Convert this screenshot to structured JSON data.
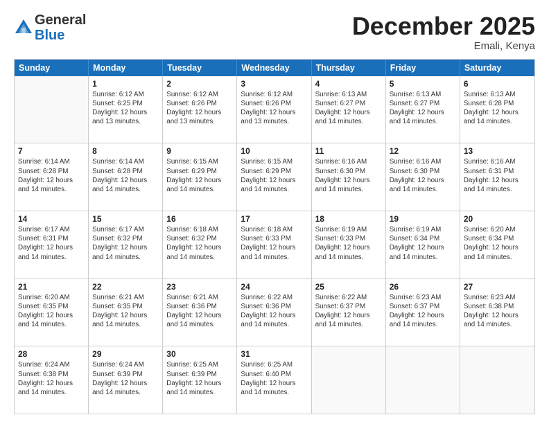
{
  "logo": {
    "general": "General",
    "blue": "Blue"
  },
  "title": "December 2025",
  "location": "Emali, Kenya",
  "header_days": [
    "Sunday",
    "Monday",
    "Tuesday",
    "Wednesday",
    "Thursday",
    "Friday",
    "Saturday"
  ],
  "weeks": [
    [
      {
        "day": "",
        "sunrise": "",
        "sunset": "",
        "daylight": ""
      },
      {
        "day": "1",
        "sunrise": "Sunrise: 6:12 AM",
        "sunset": "Sunset: 6:25 PM",
        "daylight": "Daylight: 12 hours and 13 minutes."
      },
      {
        "day": "2",
        "sunrise": "Sunrise: 6:12 AM",
        "sunset": "Sunset: 6:26 PM",
        "daylight": "Daylight: 12 hours and 13 minutes."
      },
      {
        "day": "3",
        "sunrise": "Sunrise: 6:12 AM",
        "sunset": "Sunset: 6:26 PM",
        "daylight": "Daylight: 12 hours and 13 minutes."
      },
      {
        "day": "4",
        "sunrise": "Sunrise: 6:13 AM",
        "sunset": "Sunset: 6:27 PM",
        "daylight": "Daylight: 12 hours and 14 minutes."
      },
      {
        "day": "5",
        "sunrise": "Sunrise: 6:13 AM",
        "sunset": "Sunset: 6:27 PM",
        "daylight": "Daylight: 12 hours and 14 minutes."
      },
      {
        "day": "6",
        "sunrise": "Sunrise: 6:13 AM",
        "sunset": "Sunset: 6:28 PM",
        "daylight": "Daylight: 12 hours and 14 minutes."
      }
    ],
    [
      {
        "day": "7",
        "sunrise": "Sunrise: 6:14 AM",
        "sunset": "Sunset: 6:28 PM",
        "daylight": "Daylight: 12 hours and 14 minutes."
      },
      {
        "day": "8",
        "sunrise": "Sunrise: 6:14 AM",
        "sunset": "Sunset: 6:28 PM",
        "daylight": "Daylight: 12 hours and 14 minutes."
      },
      {
        "day": "9",
        "sunrise": "Sunrise: 6:15 AM",
        "sunset": "Sunset: 6:29 PM",
        "daylight": "Daylight: 12 hours and 14 minutes."
      },
      {
        "day": "10",
        "sunrise": "Sunrise: 6:15 AM",
        "sunset": "Sunset: 6:29 PM",
        "daylight": "Daylight: 12 hours and 14 minutes."
      },
      {
        "day": "11",
        "sunrise": "Sunrise: 6:16 AM",
        "sunset": "Sunset: 6:30 PM",
        "daylight": "Daylight: 12 hours and 14 minutes."
      },
      {
        "day": "12",
        "sunrise": "Sunrise: 6:16 AM",
        "sunset": "Sunset: 6:30 PM",
        "daylight": "Daylight: 12 hours and 14 minutes."
      },
      {
        "day": "13",
        "sunrise": "Sunrise: 6:16 AM",
        "sunset": "Sunset: 6:31 PM",
        "daylight": "Daylight: 12 hours and 14 minutes."
      }
    ],
    [
      {
        "day": "14",
        "sunrise": "Sunrise: 6:17 AM",
        "sunset": "Sunset: 6:31 PM",
        "daylight": "Daylight: 12 hours and 14 minutes."
      },
      {
        "day": "15",
        "sunrise": "Sunrise: 6:17 AM",
        "sunset": "Sunset: 6:32 PM",
        "daylight": "Daylight: 12 hours and 14 minutes."
      },
      {
        "day": "16",
        "sunrise": "Sunrise: 6:18 AM",
        "sunset": "Sunset: 6:32 PM",
        "daylight": "Daylight: 12 hours and 14 minutes."
      },
      {
        "day": "17",
        "sunrise": "Sunrise: 6:18 AM",
        "sunset": "Sunset: 6:33 PM",
        "daylight": "Daylight: 12 hours and 14 minutes."
      },
      {
        "day": "18",
        "sunrise": "Sunrise: 6:19 AM",
        "sunset": "Sunset: 6:33 PM",
        "daylight": "Daylight: 12 hours and 14 minutes."
      },
      {
        "day": "19",
        "sunrise": "Sunrise: 6:19 AM",
        "sunset": "Sunset: 6:34 PM",
        "daylight": "Daylight: 12 hours and 14 minutes."
      },
      {
        "day": "20",
        "sunrise": "Sunrise: 6:20 AM",
        "sunset": "Sunset: 6:34 PM",
        "daylight": "Daylight: 12 hours and 14 minutes."
      }
    ],
    [
      {
        "day": "21",
        "sunrise": "Sunrise: 6:20 AM",
        "sunset": "Sunset: 6:35 PM",
        "daylight": "Daylight: 12 hours and 14 minutes."
      },
      {
        "day": "22",
        "sunrise": "Sunrise: 6:21 AM",
        "sunset": "Sunset: 6:35 PM",
        "daylight": "Daylight: 12 hours and 14 minutes."
      },
      {
        "day": "23",
        "sunrise": "Sunrise: 6:21 AM",
        "sunset": "Sunset: 6:36 PM",
        "daylight": "Daylight: 12 hours and 14 minutes."
      },
      {
        "day": "24",
        "sunrise": "Sunrise: 6:22 AM",
        "sunset": "Sunset: 6:36 PM",
        "daylight": "Daylight: 12 hours and 14 minutes."
      },
      {
        "day": "25",
        "sunrise": "Sunrise: 6:22 AM",
        "sunset": "Sunset: 6:37 PM",
        "daylight": "Daylight: 12 hours and 14 minutes."
      },
      {
        "day": "26",
        "sunrise": "Sunrise: 6:23 AM",
        "sunset": "Sunset: 6:37 PM",
        "daylight": "Daylight: 12 hours and 14 minutes."
      },
      {
        "day": "27",
        "sunrise": "Sunrise: 6:23 AM",
        "sunset": "Sunset: 6:38 PM",
        "daylight": "Daylight: 12 hours and 14 minutes."
      }
    ],
    [
      {
        "day": "28",
        "sunrise": "Sunrise: 6:24 AM",
        "sunset": "Sunset: 6:38 PM",
        "daylight": "Daylight: 12 hours and 14 minutes."
      },
      {
        "day": "29",
        "sunrise": "Sunrise: 6:24 AM",
        "sunset": "Sunset: 6:39 PM",
        "daylight": "Daylight: 12 hours and 14 minutes."
      },
      {
        "day": "30",
        "sunrise": "Sunrise: 6:25 AM",
        "sunset": "Sunset: 6:39 PM",
        "daylight": "Daylight: 12 hours and 14 minutes."
      },
      {
        "day": "31",
        "sunrise": "Sunrise: 6:25 AM",
        "sunset": "Sunset: 6:40 PM",
        "daylight": "Daylight: 12 hours and 14 minutes."
      },
      {
        "day": "",
        "sunrise": "",
        "sunset": "",
        "daylight": ""
      },
      {
        "day": "",
        "sunrise": "",
        "sunset": "",
        "daylight": ""
      },
      {
        "day": "",
        "sunrise": "",
        "sunset": "",
        "daylight": ""
      }
    ]
  ]
}
